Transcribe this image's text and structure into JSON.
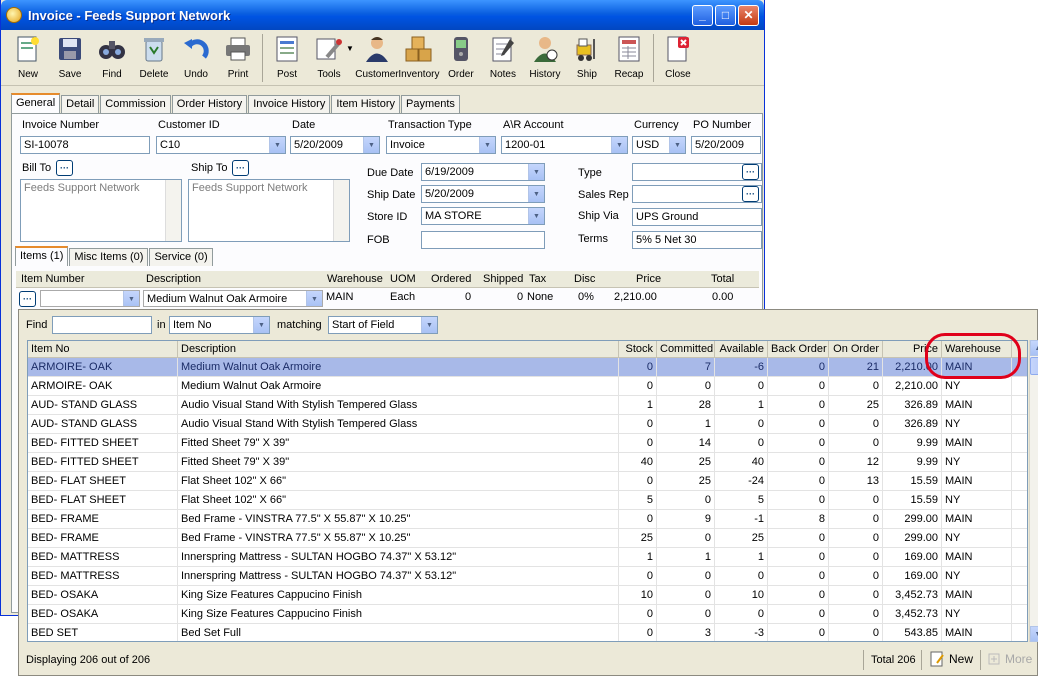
{
  "window": {
    "title": "Invoice - Feeds Support Network",
    "min": "_",
    "max": "□",
    "close": "✕"
  },
  "toolbar": [
    {
      "name": "new",
      "label": "New"
    },
    {
      "name": "save",
      "label": "Save"
    },
    {
      "name": "find",
      "label": "Find"
    },
    {
      "name": "delete",
      "label": "Delete"
    },
    {
      "name": "undo",
      "label": "Undo"
    },
    {
      "name": "print",
      "label": "Print"
    },
    {
      "name": "post",
      "label": "Post"
    },
    {
      "name": "tools",
      "label": "Tools"
    },
    {
      "name": "customer",
      "label": "Customer"
    },
    {
      "name": "inventory",
      "label": "Inventory"
    },
    {
      "name": "order",
      "label": "Order"
    },
    {
      "name": "notes",
      "label": "Notes"
    },
    {
      "name": "history",
      "label": "History"
    },
    {
      "name": "ship",
      "label": "Ship"
    },
    {
      "name": "recap",
      "label": "Recap"
    },
    {
      "name": "close",
      "label": "Close"
    }
  ],
  "tabs": [
    "General",
    "Detail",
    "Commission",
    "Order History",
    "Invoice History",
    "Item History",
    "Payments"
  ],
  "form": {
    "invoice_number_label": "Invoice Number",
    "invoice_number": "SI-10078",
    "customer_id_label": "Customer ID",
    "customer_id": "C10",
    "date_label": "Date",
    "date": "5/20/2009",
    "transaction_type_label": "Transaction Type",
    "transaction_type": "Invoice",
    "ar_account_label": "A\\R Account",
    "ar_account": "1200-01",
    "currency_label": "Currency",
    "currency": "USD",
    "po_number_label": "PO Number",
    "po_number": "5/20/2009",
    "bill_to_label": "Bill To",
    "bill_to": "Feeds Support Network",
    "ship_to_label": "Ship To",
    "ship_to": "Feeds Support Network",
    "due_date_label": "Due Date",
    "due_date": "6/19/2009",
    "ship_date_label": "Ship Date",
    "ship_date": "5/20/2009",
    "store_id_label": "Store ID",
    "store_id": "MA STORE",
    "fob_label": "FOB",
    "fob": "",
    "type_label": "Type",
    "type": "",
    "sales_rep_label": "Sales Rep",
    "sales_rep": "",
    "ship_via_label": "Ship Via",
    "ship_via": "UPS Ground",
    "terms_label": "Terms",
    "terms": "5% 5 Net 30",
    "ellipsis": "···"
  },
  "item_tabs": [
    "Items (1)",
    "Misc Items (0)",
    "Service (0)"
  ],
  "items_table": {
    "headers": [
      "Item Number",
      "Description",
      "Warehouse",
      "UOM",
      "Ordered",
      "Shipped",
      "Tax",
      "Disc",
      "Price",
      "Total"
    ],
    "row": [
      "",
      "Medium Walnut Oak Armoire",
      "MAIN",
      "Each",
      "0",
      "0",
      "None",
      "0%",
      "2,210.00",
      "0.00"
    ]
  },
  "finder": {
    "find_label": "Find",
    "find_value": "",
    "in_label": "in",
    "in_value": "Item No",
    "matching_label": "matching",
    "matching_value": "Start of Field"
  },
  "grid": {
    "headers": [
      "Item No",
      "Description",
      "Stock",
      "Committed",
      "Available",
      "Back Order",
      "On Order",
      "Price",
      "Warehouse"
    ],
    "rows": [
      [
        "ARMOIRE- OAK",
        "Medium Walnut Oak Armoire",
        "0",
        "7",
        "-6",
        "0",
        "21",
        "2,210.00",
        "MAIN"
      ],
      [
        "ARMOIRE- OAK",
        "Medium Walnut Oak Armoire",
        "0",
        "0",
        "0",
        "0",
        "0",
        "2,210.00",
        "NY"
      ],
      [
        "AUD- STAND GLASS",
        "Audio Visual Stand With Stylish Tempered Glass",
        "1",
        "28",
        "1",
        "0",
        "25",
        "326.89",
        "MAIN"
      ],
      [
        "AUD- STAND GLASS",
        "Audio Visual Stand With Stylish Tempered Glass",
        "0",
        "1",
        "0",
        "0",
        "0",
        "326.89",
        "NY"
      ],
      [
        "BED- FITTED SHEET",
        "Fitted Sheet 79\" X 39\"",
        "0",
        "14",
        "0",
        "0",
        "0",
        "9.99",
        "MAIN"
      ],
      [
        "BED- FITTED SHEET",
        "Fitted Sheet 79\" X 39\"",
        "40",
        "25",
        "40",
        "0",
        "12",
        "9.99",
        "NY"
      ],
      [
        "BED- FLAT SHEET",
        "Flat Sheet 102\" X 66\"",
        "0",
        "25",
        "-24",
        "0",
        "13",
        "15.59",
        "MAIN"
      ],
      [
        "BED- FLAT SHEET",
        "Flat Sheet 102\" X 66\"",
        "5",
        "0",
        "5",
        "0",
        "0",
        "15.59",
        "NY"
      ],
      [
        "BED- FRAME",
        "Bed Frame - VINSTRA 77.5\" X 55.87\" X 10.25\"",
        "0",
        "9",
        "-1",
        "8",
        "0",
        "299.00",
        "MAIN"
      ],
      [
        "BED- FRAME",
        "Bed Frame - VINSTRA 77.5\" X 55.87\" X 10.25\"",
        "25",
        "0",
        "25",
        "0",
        "0",
        "299.00",
        "NY"
      ],
      [
        "BED- MATTRESS",
        "Innerspring Mattress - SULTAN HOGBO 74.37\" X 53.12\"",
        "1",
        "1",
        "1",
        "0",
        "0",
        "169.00",
        "MAIN"
      ],
      [
        "BED- MATTRESS",
        "Innerspring Mattress - SULTAN HOGBO 74.37\" X 53.12\"",
        "0",
        "0",
        "0",
        "0",
        "0",
        "169.00",
        "NY"
      ],
      [
        "BED- OSAKA",
        "King Size Features Cappucino Finish",
        "10",
        "0",
        "10",
        "0",
        "0",
        "3,452.73",
        "MAIN"
      ],
      [
        "BED- OSAKA",
        "King Size Features Cappucino Finish",
        "0",
        "0",
        "0",
        "0",
        "0",
        "3,452.73",
        "NY"
      ],
      [
        "BED SET",
        "Bed Set Full",
        "0",
        "3",
        "-3",
        "0",
        "0",
        "543.85",
        "MAIN"
      ]
    ]
  },
  "status": {
    "displaying": "Displaying 206 out of 206",
    "total": "Total 206",
    "new": "New",
    "more": "More"
  },
  "colors": {
    "selected_row": "#a8b9e8",
    "highlight": "#e0001a",
    "titlebar": "#0054e3"
  }
}
